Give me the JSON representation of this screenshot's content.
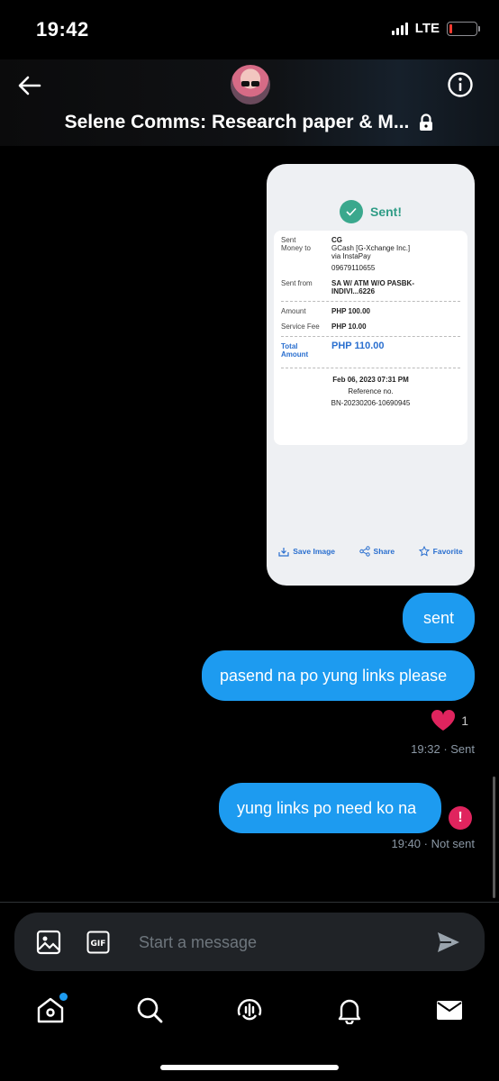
{
  "status_bar": {
    "time": "19:42",
    "network": "LTE",
    "battery_color": "#ff3b30"
  },
  "header": {
    "title": "Selene Comms: Research paper & M..."
  },
  "receipt": {
    "status": "Sent!",
    "sent_money_to_label": "Sent\nMoney to",
    "recipient_name": "CG",
    "recipient_detail": "GCash [G-Xchange Inc.]\nvia InstaPay",
    "recipient_number": "09679110655",
    "sent_from_label": "Sent from",
    "sent_from_value": "SA W/ ATM W/O PASBK-\nINDIVI...6226",
    "amount_label": "Amount",
    "amount_value": "PHP 100.00",
    "fee_label": "Service Fee",
    "fee_value": "PHP 10.00",
    "total_label": "Total\nAmount",
    "total_value": "PHP 110.00",
    "date": "Feb 06, 2023 07:31 PM",
    "reference_label": "Reference no.",
    "reference_value": "BN-20230206-10690945",
    "actions": {
      "save": "Save Image",
      "share": "Share",
      "favorite": "Favorite"
    }
  },
  "messages": [
    {
      "text": "sent"
    },
    {
      "text": "pasend na po yung links please"
    },
    {
      "text": "yung links po need ko na"
    }
  ],
  "reaction": {
    "count": "1"
  },
  "meta": {
    "first": "19:32 · Sent",
    "second": "19:40 · Not sent"
  },
  "error_mark": "!",
  "composer": {
    "placeholder": "Start a message"
  },
  "colors": {
    "accent": "#1d9bf0",
    "error": "#e0245e",
    "heart": "#e0245e"
  }
}
